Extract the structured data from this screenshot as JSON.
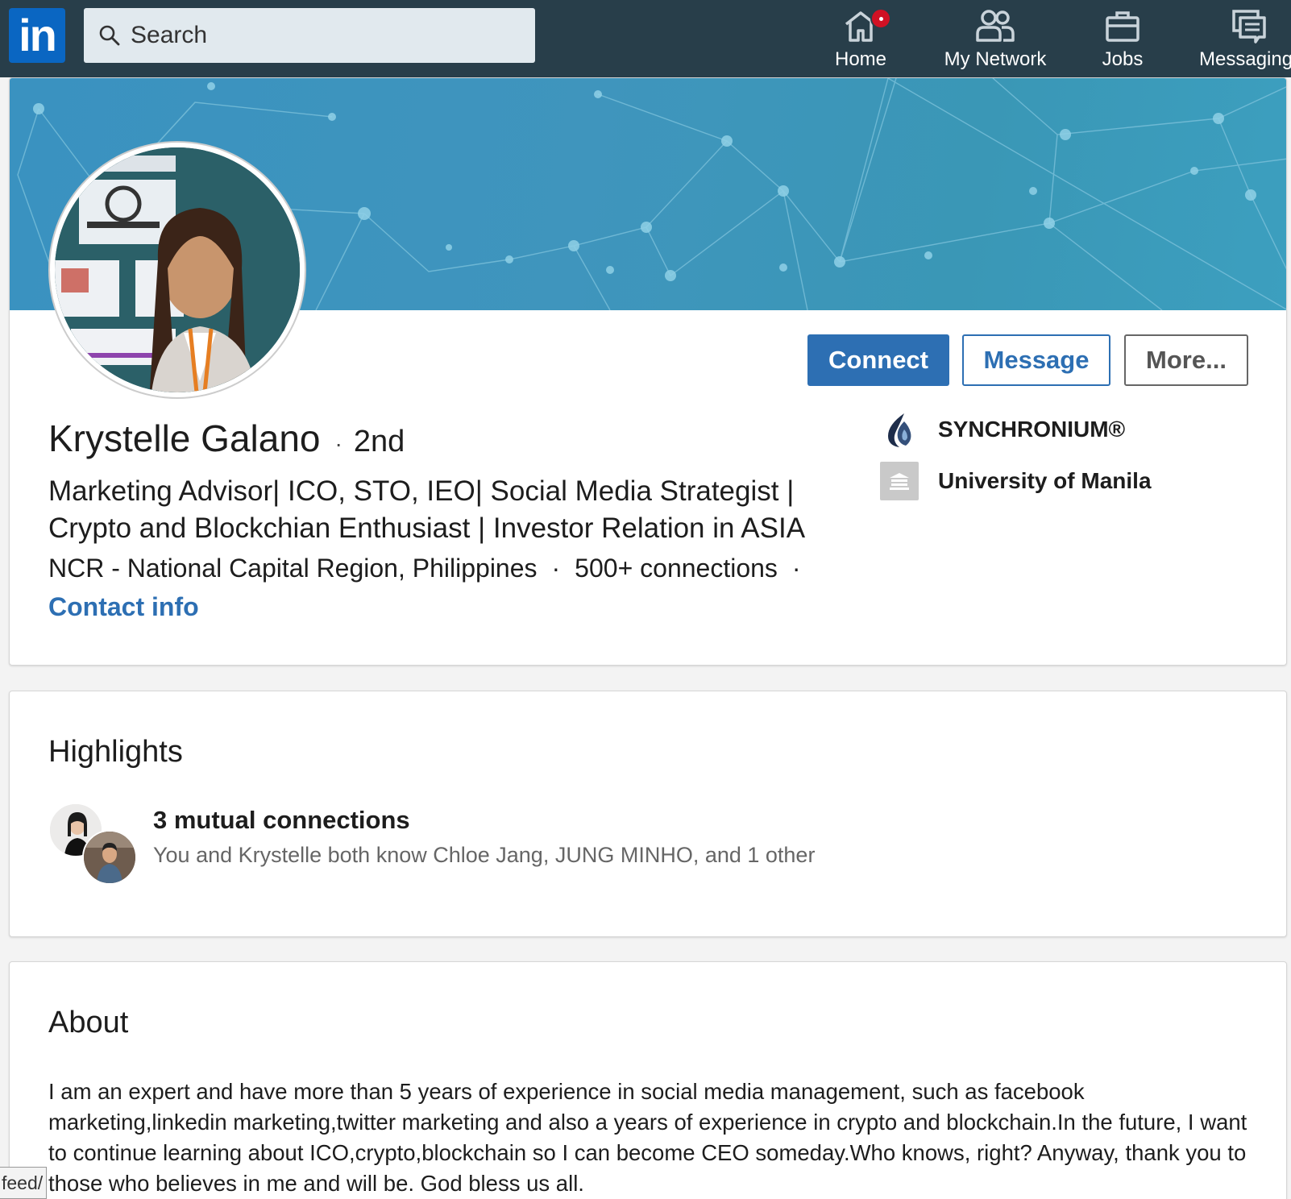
{
  "nav": {
    "logo_text": "in",
    "search_placeholder": "Search",
    "items": [
      {
        "label": "Home",
        "icon": "home-icon",
        "has_badge": true
      },
      {
        "label": "My Network",
        "icon": "network-icon"
      },
      {
        "label": "Jobs",
        "icon": "briefcase-icon"
      },
      {
        "label": "Messaging",
        "icon": "messaging-icon"
      }
    ]
  },
  "profile": {
    "name": "Krystelle Galano",
    "degree_sep": "·",
    "degree": "2nd",
    "headline": "Marketing Advisor| ICO, STO, IEO| Social Media Strategist | Crypto and Blockchian Enthusiast | Investor Relation in ASIA",
    "location": "NCR - National Capital Region, Philippines",
    "separator": "·",
    "connections": "500+ connections",
    "contact_info": "Contact info",
    "company": "SYNCHRONIUM®",
    "school": "University of Manila",
    "actions": {
      "connect": "Connect",
      "message": "Message",
      "more": "More..."
    }
  },
  "highlights": {
    "title": "Highlights",
    "mutual_title": "3 mutual connections",
    "mutual_sub": "You and Krystelle both know Chloe Jang, JUNG MINHO, and 1 other"
  },
  "about": {
    "title": "About",
    "text": "I am an expert and have more than 5 years of experience in social media management, such as facebook marketing,linkedin marketing,twitter marketing and also a years of experience in crypto and blockchain.In the future, I want to continue learning about ICO,crypto,blockchain so I can become CEO someday.Who knows, right? Anyway, thank you to those who believes in me and will be. God bless us all."
  },
  "status_bar": {
    "url_fragment": "feed/"
  },
  "colors": {
    "nav_bg": "#283e4a",
    "brand_blue": "#0a66c2",
    "link_blue": "#2d6fb3",
    "cover_blue": "#3a92c0"
  }
}
